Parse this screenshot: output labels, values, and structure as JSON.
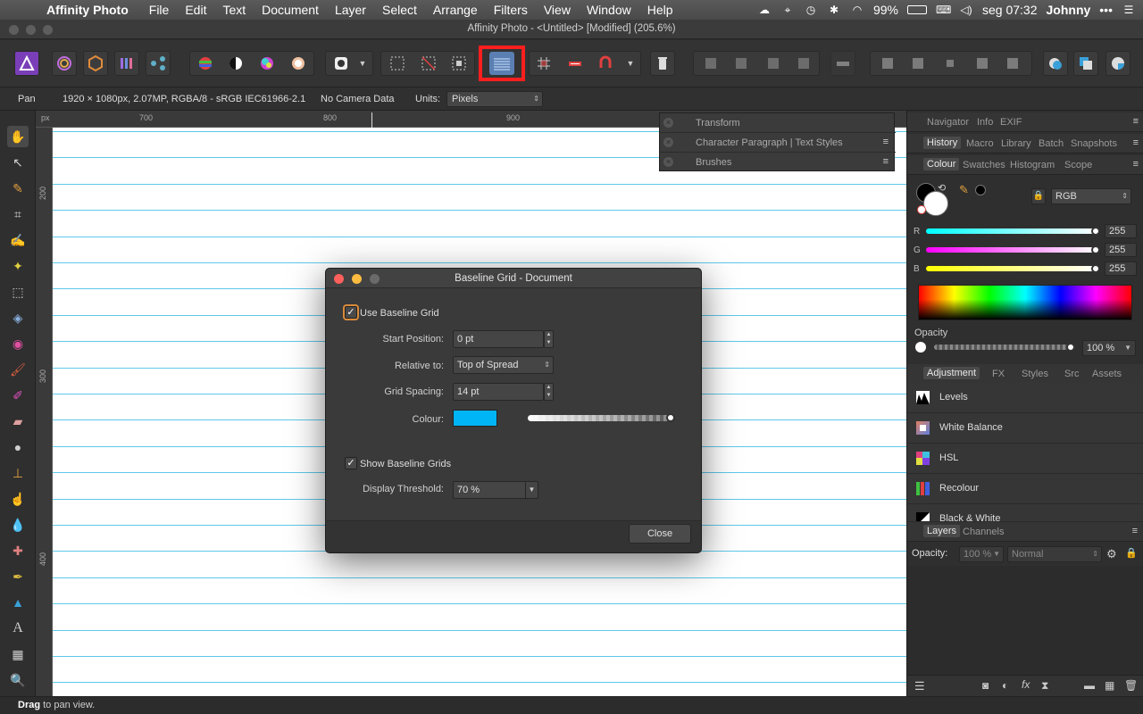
{
  "menubar": {
    "app_name": "Affinity Photo",
    "items": [
      "File",
      "Edit",
      "Text",
      "Document",
      "Layer",
      "Select",
      "Arrange",
      "Filters",
      "View",
      "Window",
      "Help"
    ],
    "battery": "99%",
    "clock": "seg 07:32",
    "user": "Johnny"
  },
  "window": {
    "title": "Affinity Photo - <Untitled> [Modified] (205.6%)"
  },
  "context_bar": {
    "tool": "Pan",
    "doc_info": "1920 × 1080px, 2.07MP, RGBA/8 - sRGB IEC61966-2.1",
    "camera": "No Camera Data",
    "units_label": "Units:",
    "units_value": "Pixels"
  },
  "rulers": {
    "unit": "px",
    "top_labels": [
      "700",
      "800",
      "900"
    ],
    "left_labels": [
      "200",
      "300",
      "400"
    ]
  },
  "float_panels": {
    "transform": "Transform",
    "character_tabs": "Character   Paragraph | Text Styles",
    "brushes": "Brushes"
  },
  "right_panel": {
    "tabs_row1": [
      "Navigator",
      "Info",
      "EXIF"
    ],
    "tabs_row2": [
      "History",
      "Macro",
      "Library",
      "Batch",
      "Snapshots"
    ],
    "tabs_row3": [
      "Colour",
      "Swatches",
      "Histogram",
      "Scope"
    ],
    "colour_mode": "RGB",
    "r_label": "R",
    "r_value": "255",
    "g_label": "G",
    "g_value": "255",
    "b_label": "B",
    "b_value": "255",
    "opacity_label": "Opacity",
    "opacity_value": "100 %",
    "tabs_row4": [
      "Adjustment",
      "FX",
      "Styles",
      "Src",
      "Assets"
    ],
    "adjustments": [
      "Levels",
      "White Balance",
      "HSL",
      "Recolour",
      "Black & White"
    ],
    "tabs_row5": [
      "Layers",
      "Channels"
    ],
    "layers_opacity_label": "Opacity:",
    "layers_opacity_value": "100 %",
    "blend_mode": "Normal"
  },
  "dialog": {
    "title": "Baseline Grid - Document",
    "use_baseline_grid": "Use Baseline Grid",
    "start_position_label": "Start Position:",
    "start_position_value": "0 pt",
    "relative_to_label": "Relative to:",
    "relative_to_value": "Top of Spread",
    "grid_spacing_label": "Grid Spacing:",
    "grid_spacing_value": "14 pt",
    "colour_label": "Colour:",
    "colour_value": "#00b5f5",
    "show_baseline_grids": "Show Baseline Grids",
    "display_threshold_label": "Display Threshold:",
    "display_threshold_value": "70 %",
    "close_label": "Close"
  },
  "status": {
    "bold": "Drag",
    "text": " to pan view."
  },
  "colors": {
    "accent_highlight": "#ff1e1e",
    "grid_line": "#5ec8ea",
    "swatch": "#00b5f5"
  }
}
